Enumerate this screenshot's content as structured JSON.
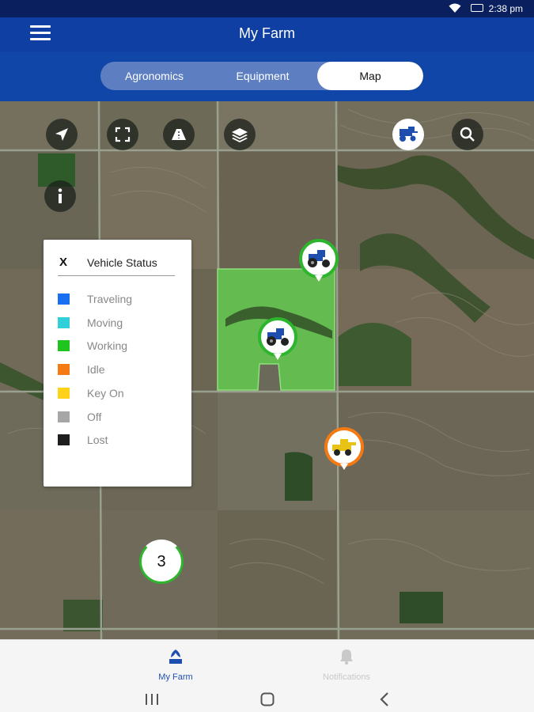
{
  "status_bar": {
    "time": "2:38 pm"
  },
  "app_bar": {
    "title": "My Farm"
  },
  "tabs": [
    {
      "label": "Agronomics",
      "active": false
    },
    {
      "label": "Equipment",
      "active": false
    },
    {
      "label": "Map",
      "active": true
    }
  ],
  "map_controls": {
    "left": [
      "location-arrow-icon",
      "fullscreen-icon",
      "road-icon",
      "layers-icon"
    ],
    "right": [
      "equipment-filter-icon",
      "search-icon"
    ],
    "info": "info-icon"
  },
  "legend": {
    "close_label": "X",
    "title": "Vehicle Status",
    "items": [
      {
        "label": "Traveling",
        "color": "#1a6ef0"
      },
      {
        "label": "Moving",
        "color": "#2fd0d8"
      },
      {
        "label": "Working",
        "color": "#1fc41f"
      },
      {
        "label": "Idle",
        "color": "#f47a14"
      },
      {
        "label": "Key On",
        "color": "#ffd21a"
      },
      {
        "label": "Off",
        "color": "#a6a6a6"
      },
      {
        "label": "Lost",
        "color": "#1e1e1e"
      }
    ]
  },
  "markers": [
    {
      "type": "tractor",
      "status": "Working",
      "color": "#2db52d"
    },
    {
      "type": "tractor",
      "status": "Working",
      "color": "#2db52d"
    },
    {
      "type": "combine",
      "status": "Idle",
      "color": "#f47a14"
    }
  ],
  "cluster": {
    "count": "3"
  },
  "bottom_nav": [
    {
      "label": "My Farm",
      "active": true,
      "icon": "farm-icon"
    },
    {
      "label": "Notifications",
      "active": false,
      "icon": "bell-icon"
    }
  ],
  "colors": {
    "brand": "#0f3fa3",
    "active_nav": "#1f4fae",
    "working": "#2db52d",
    "idle": "#f47a14"
  }
}
